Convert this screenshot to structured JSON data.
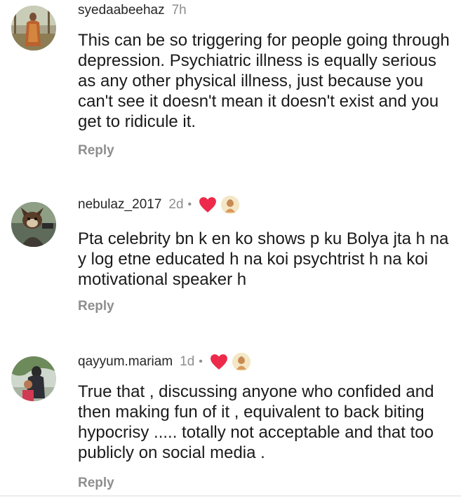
{
  "comments": [
    {
      "username": "syedaabeehaz",
      "time": "7h",
      "text": "This can be so triggering for people going through depression. Psychiatric illness is equally serious as any other physical illness, just because you can't see it doesn't mean it doesn't exist and you get to ridicule it.",
      "reply_label": "Reply",
      "liked_by_creator": false
    },
    {
      "username": "nebulaz_2017",
      "time": "2d",
      "separator": "•",
      "text": "Pta celebrity bn k en ko shows p ku Bolya jta h na y log etne educated h na koi psychtrist h na koi motivational speaker h",
      "reply_label": "Reply",
      "liked_by_creator": true
    },
    {
      "username": "qayyum.mariam",
      "time": "1d",
      "separator": "•",
      "text": "True that , discussing anyone who confided and then making fun of it , equivalent to back biting hypocrisy ..... totally not acceptable and that too publicly on social media .",
      "reply_label": "Reply",
      "liked_by_creator": true
    }
  ],
  "icons": {
    "heart": "heart-icon",
    "creator_avatar": "creator-avatar-icon"
  },
  "colors": {
    "heart": "#ed2a4a",
    "muted": "#8e8e8e",
    "username": "#262626"
  }
}
